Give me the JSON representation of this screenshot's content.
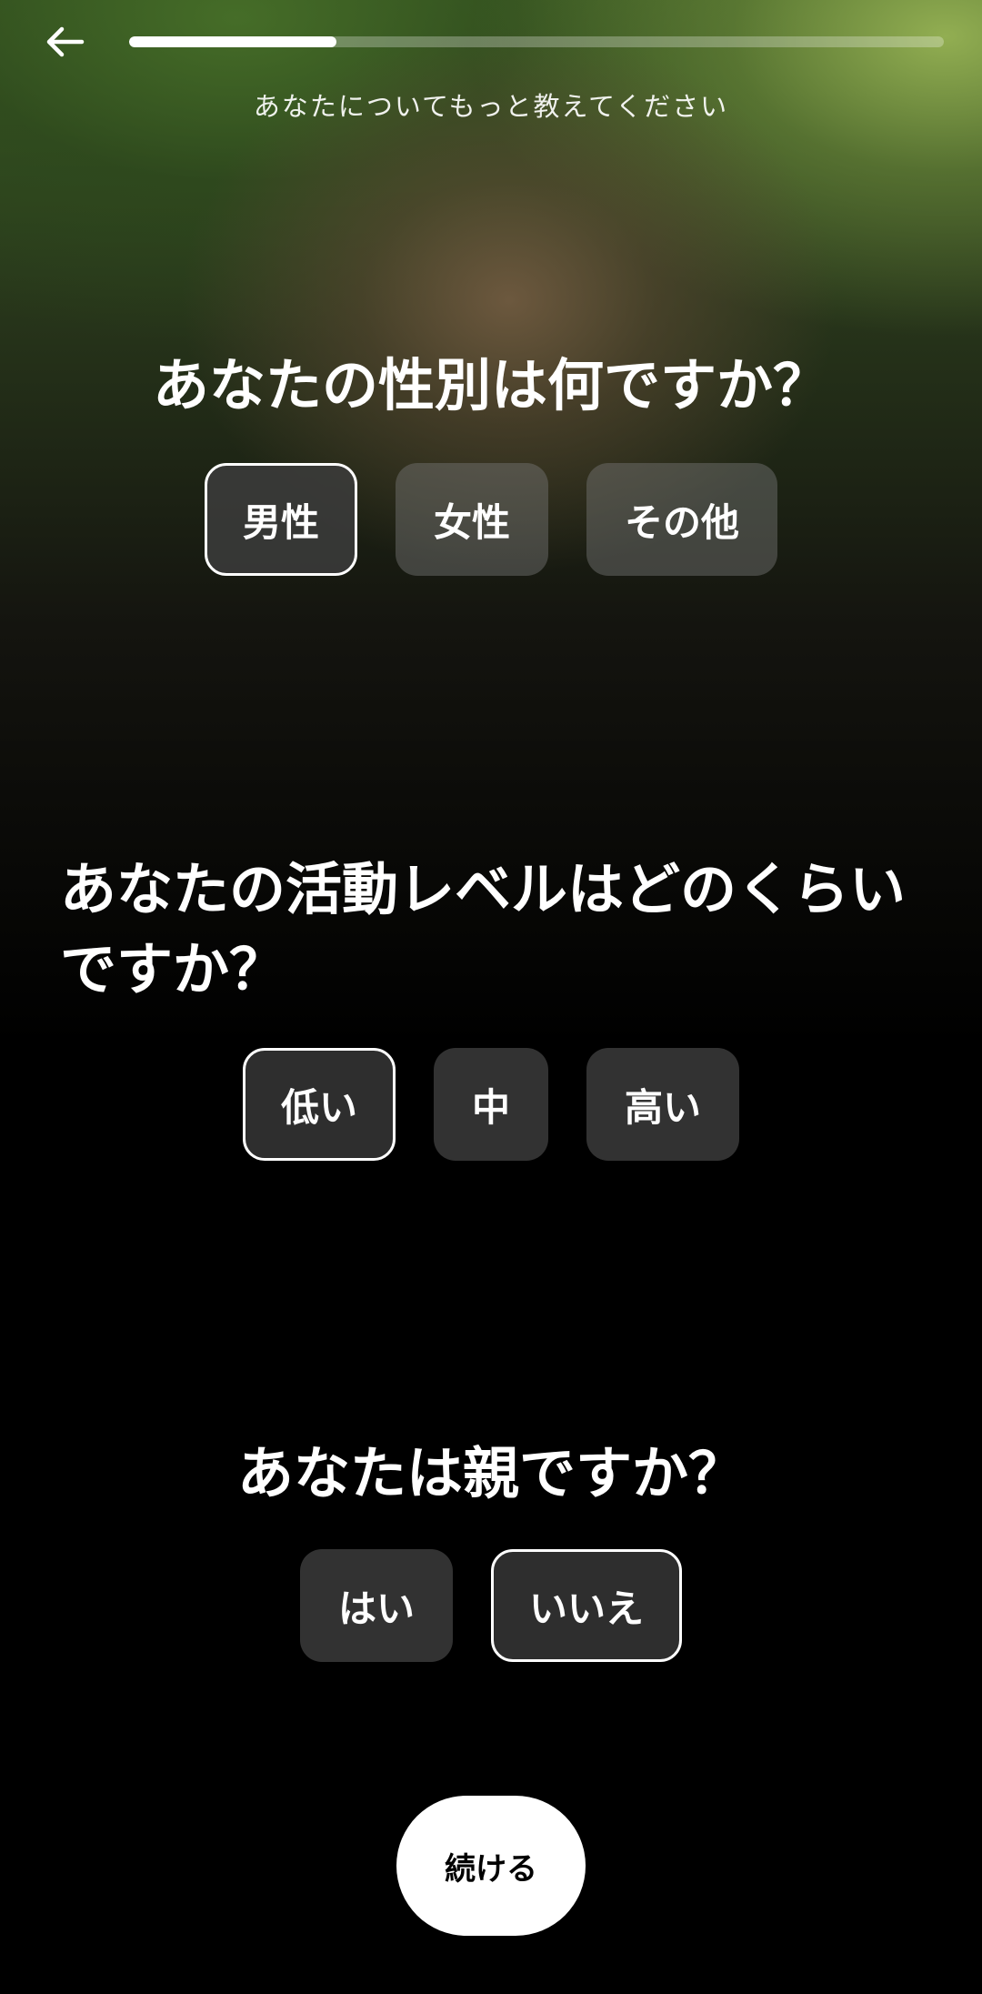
{
  "header": {
    "subtitle": "あなたについてもっと教えてください",
    "progress_fraction": 0.255
  },
  "questions": [
    {
      "title": "あなたの性別は何ですか？",
      "options": [
        "男性",
        "女性",
        "その他"
      ],
      "selected": "男性"
    },
    {
      "title": "あなたの活動レベルはどのくらいですか？",
      "options": [
        "低い",
        "中",
        "高い"
      ],
      "selected": "低い"
    },
    {
      "title": "あなたは親ですか？",
      "options": [
        "はい",
        "いいえ"
      ],
      "selected": "いいえ"
    }
  ],
  "continue_label": "続ける",
  "colors": {
    "background": "#000000",
    "accent": "#ffffff",
    "option_dark": "#323232"
  },
  "icons": {
    "back": "arrow-left-icon"
  }
}
